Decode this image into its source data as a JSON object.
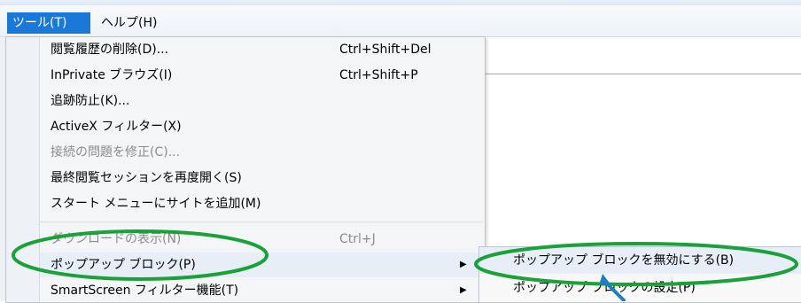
{
  "menubar": {
    "tools_label": "ツール(T)",
    "help_label": "ヘルプ(H)"
  },
  "menu": {
    "items": [
      {
        "label": "閲覧履歴の削除(D)...",
        "shortcut": "Ctrl+Shift+Del"
      },
      {
        "label": "InPrivate ブラウズ(I)",
        "shortcut": "Ctrl+Shift+P"
      },
      {
        "label": "追跡防止(K)..."
      },
      {
        "label": "ActiveX フィルター(X)"
      },
      {
        "label": "接続の問題を修正(C)..."
      },
      {
        "label": "最終閲覧セッションを再度開く(S)"
      },
      {
        "label": "スタート メニューにサイトを追加(M)"
      },
      {
        "label": "ダウンロードの表示(N)",
        "shortcut": "Ctrl+J"
      },
      {
        "label": "ポップアップ ブロック(P)"
      },
      {
        "label": "SmartScreen フィルター機能(T)"
      }
    ]
  },
  "submenu": {
    "items": [
      {
        "label": "ポップアップ ブロックを無効にする(B)"
      },
      {
        "label": "ポップアップ ブロックの設定(P)"
      }
    ]
  },
  "annotation": {
    "color": "#1aa13a"
  }
}
